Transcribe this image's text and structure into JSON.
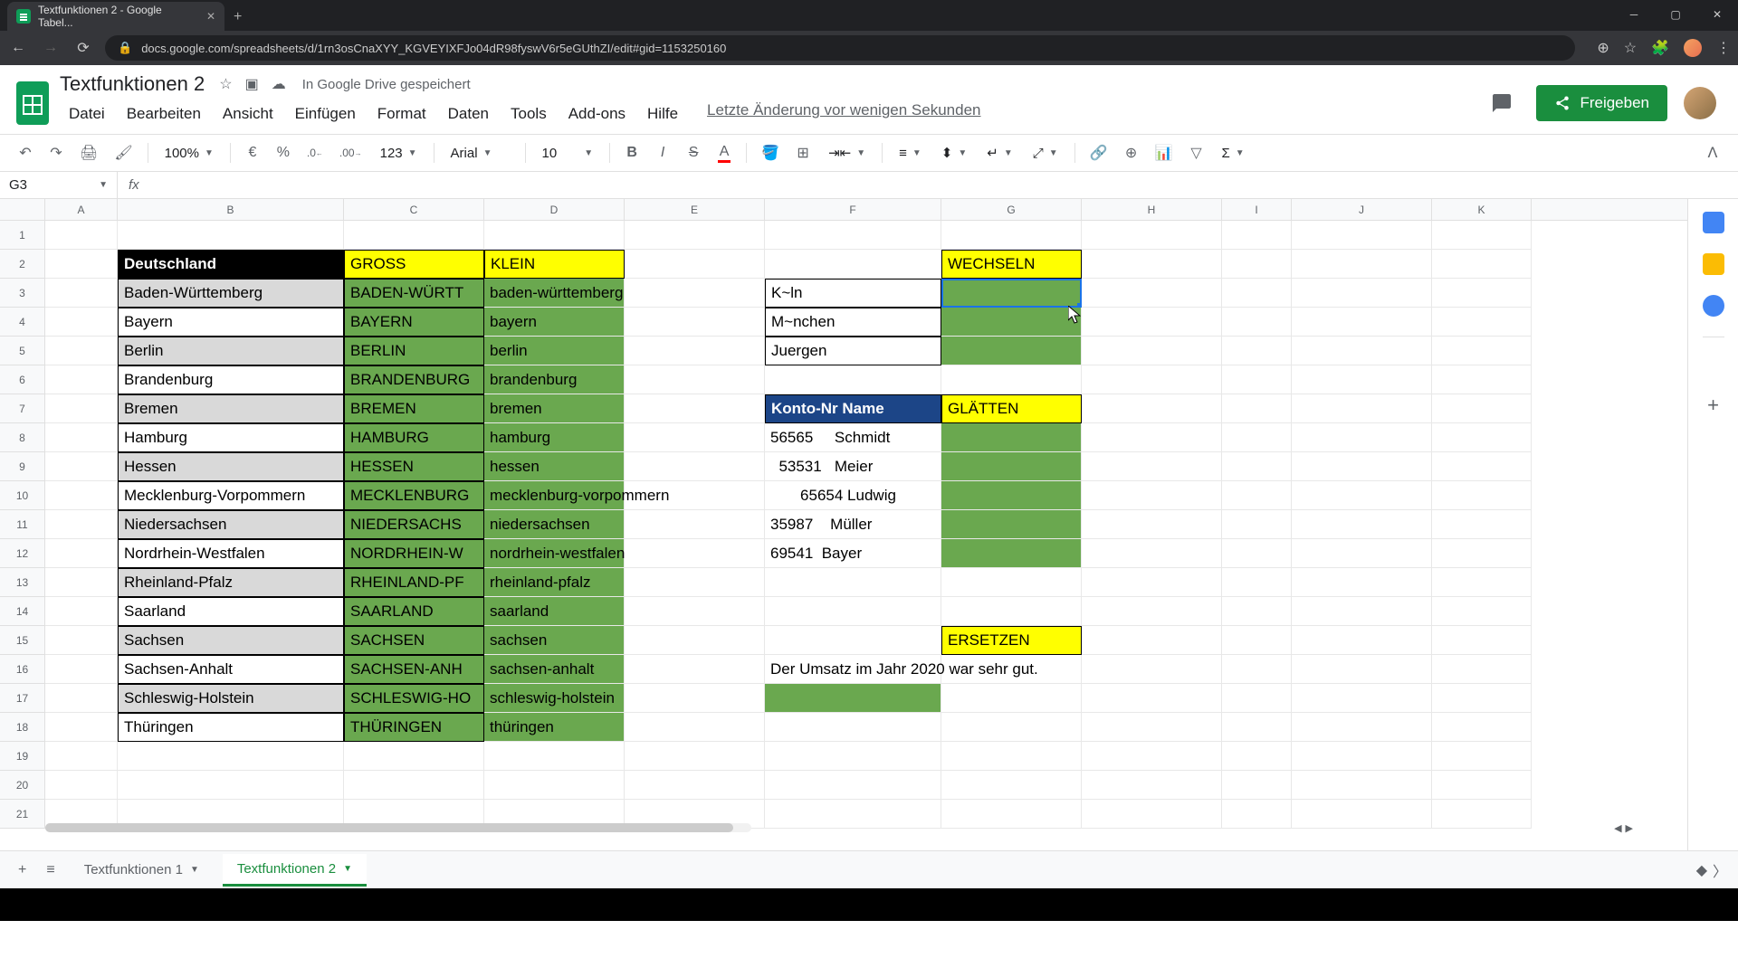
{
  "browser": {
    "tab_title": "Textfunktionen 2 - Google Tabel...",
    "url": "docs.google.com/spreadsheets/d/1rn3osCnaXYY_KGVEYIXFJo04dR98fyswV6r5eGUthZI/edit#gid=1153250160"
  },
  "doc": {
    "title": "Textfunktionen 2",
    "save_status": "In Google Drive gespeichert",
    "share_label": "Freigeben",
    "last_edit": "Letzte Änderung vor wenigen Sekunden"
  },
  "menus": [
    "Datei",
    "Bearbeiten",
    "Ansicht",
    "Einfügen",
    "Format",
    "Daten",
    "Tools",
    "Add-ons",
    "Hilfe"
  ],
  "toolbar": {
    "zoom": "100%",
    "currency": "€",
    "percent": "%",
    "dec_less": ".0",
    "dec_more": ".00",
    "format_num": "123",
    "font": "Arial",
    "size": "10"
  },
  "name_box": "G3",
  "columns": [
    "A",
    "B",
    "C",
    "D",
    "E",
    "F",
    "G",
    "H",
    "I",
    "J",
    "K"
  ],
  "headers": {
    "deutschland": "Deutschland",
    "gross": "GROSS",
    "klein": "KLEIN",
    "wechseln": "WECHSELN",
    "konto": "Konto-Nr Name",
    "glaetten": "GLÄTTEN",
    "ersetzen": "ERSETZEN"
  },
  "states": [
    {
      "b": "Baden-Württemberg",
      "c": "BADEN-WÜRTT",
      "d": "baden-württemberg"
    },
    {
      "b": "Bayern",
      "c": "BAYERN",
      "d": "bayern"
    },
    {
      "b": "Berlin",
      "c": "BERLIN",
      "d": "berlin"
    },
    {
      "b": "Brandenburg",
      "c": "BRANDENBURG",
      "d": "brandenburg"
    },
    {
      "b": "Bremen",
      "c": "BREMEN",
      "d": "bremen"
    },
    {
      "b": "Hamburg",
      "c": "HAMBURG",
      "d": "hamburg"
    },
    {
      "b": "Hessen",
      "c": "HESSEN",
      "d": "hessen"
    },
    {
      "b": "Mecklenburg-Vorpommern",
      "c": "MECKLENBURG",
      "d": "mecklenburg-vorpommern"
    },
    {
      "b": "Niedersachsen",
      "c": "NIEDERSACHS",
      "d": "niedersachsen"
    },
    {
      "b": "Nordrhein-Westfalen",
      "c": "NORDRHEIN-W",
      "d": "nordrhein-westfalen"
    },
    {
      "b": "Rheinland-Pfalz",
      "c": "RHEINLAND-PF",
      "d": "rheinland-pfalz"
    },
    {
      "b": "Saarland",
      "c": "SAARLAND",
      "d": "saarland"
    },
    {
      "b": "Sachsen",
      "c": "SACHSEN",
      "d": "sachsen"
    },
    {
      "b": "Sachsen-Anhalt",
      "c": "SACHSEN-ANH",
      "d": "sachsen-anhalt"
    },
    {
      "b": "Schleswig-Holstein",
      "c": "SCHLESWIG-HO",
      "d": "schleswig-holstein"
    },
    {
      "b": "Thüringen",
      "c": "THÜRINGEN",
      "d": "thüringen"
    }
  ],
  "wechseln_src": [
    "K~ln",
    "M~nchen",
    "Juergen"
  ],
  "konto_rows": [
    "56565     Schmidt",
    "  53531   Meier",
    "       65654 Ludwig",
    "35987    Müller",
    "69541  Bayer"
  ],
  "ersetzen_text": "Der Umsatz im Jahr 2020 war sehr gut.",
  "sheets": [
    "Textfunktionen 1",
    "Textfunktionen 2"
  ],
  "active_sheet": 1
}
